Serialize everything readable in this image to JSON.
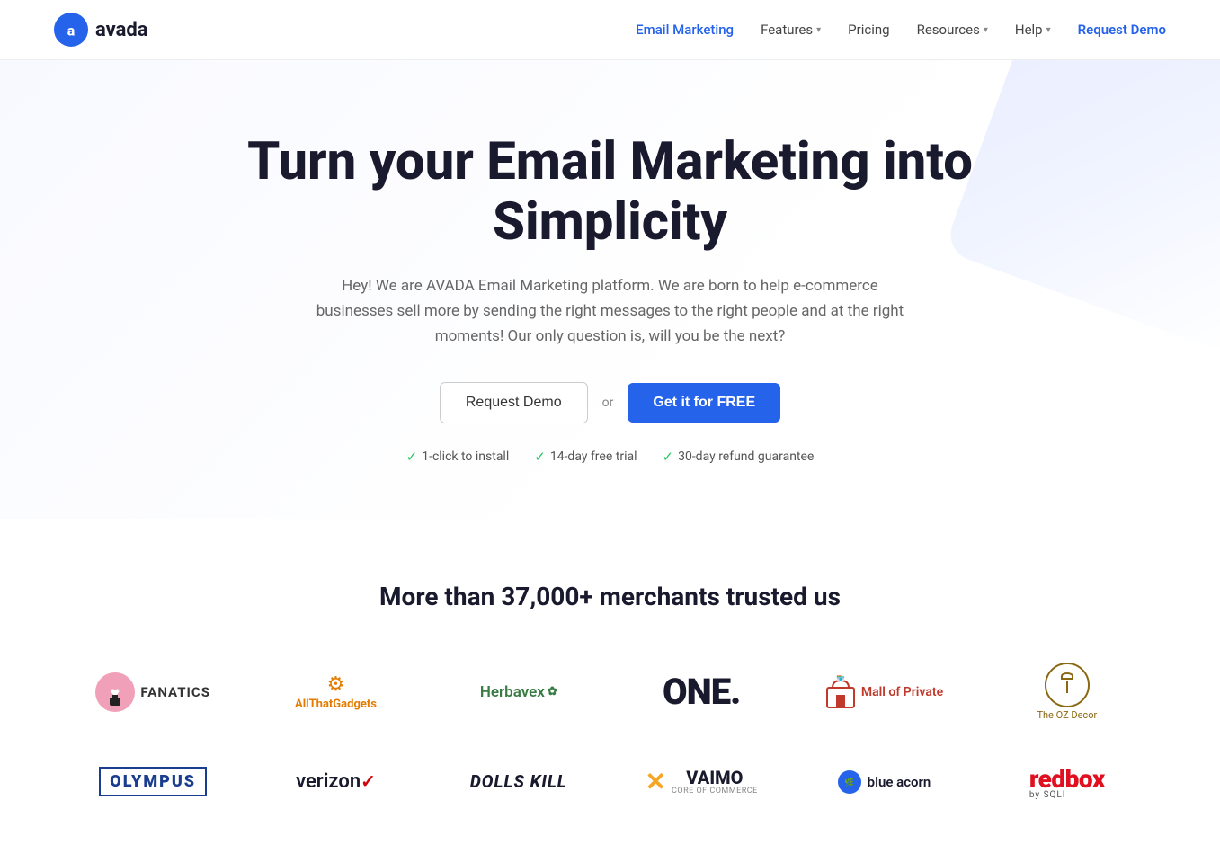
{
  "header": {
    "logo_text": "avada",
    "nav_items": [
      {
        "label": "Email Marketing",
        "active": true,
        "has_dropdown": false
      },
      {
        "label": "Features",
        "active": false,
        "has_dropdown": true
      },
      {
        "label": "Pricing",
        "active": false,
        "has_dropdown": false
      },
      {
        "label": "Resources",
        "active": false,
        "has_dropdown": true
      },
      {
        "label": "Help",
        "active": false,
        "has_dropdown": true
      }
    ],
    "cta_label": "Request Demo"
  },
  "hero": {
    "headline": "Turn your Email Marketing into Simplicity",
    "subtitle": "Hey! We are AVADA Email Marketing platform. We are born to help e-commerce businesses sell more by sending the right messages to the right people and at the right moments! Our only question is, will you be the next?",
    "btn_demo": "Request Demo",
    "btn_or": "or",
    "btn_free": "Get it for FREE",
    "badges": [
      "1-click to install",
      "14-day free trial",
      "30-day refund guarantee"
    ]
  },
  "merchants": {
    "title": "More than 37,000+ merchants trusted us",
    "brands_row1": [
      {
        "id": "fanatics",
        "name": "Fanatics"
      },
      {
        "id": "allthat",
        "name": "AllThatGadgets"
      },
      {
        "id": "herbavex",
        "name": "Herbavex"
      },
      {
        "id": "one",
        "name": "ONE."
      },
      {
        "id": "mall",
        "name": "Mall of Private"
      },
      {
        "id": "oz",
        "name": "The OZ Decor"
      }
    ],
    "brands_row2": [
      {
        "id": "olympus",
        "name": "OLYMPUS"
      },
      {
        "id": "verizon",
        "name": "verizon"
      },
      {
        "id": "dolls",
        "name": "DOLLS KILL"
      },
      {
        "id": "vaimo",
        "name": "VAIMO"
      },
      {
        "id": "blueacorn",
        "name": "blue acorn"
      },
      {
        "id": "redbox",
        "name": "redbox by SQLI"
      }
    ]
  }
}
